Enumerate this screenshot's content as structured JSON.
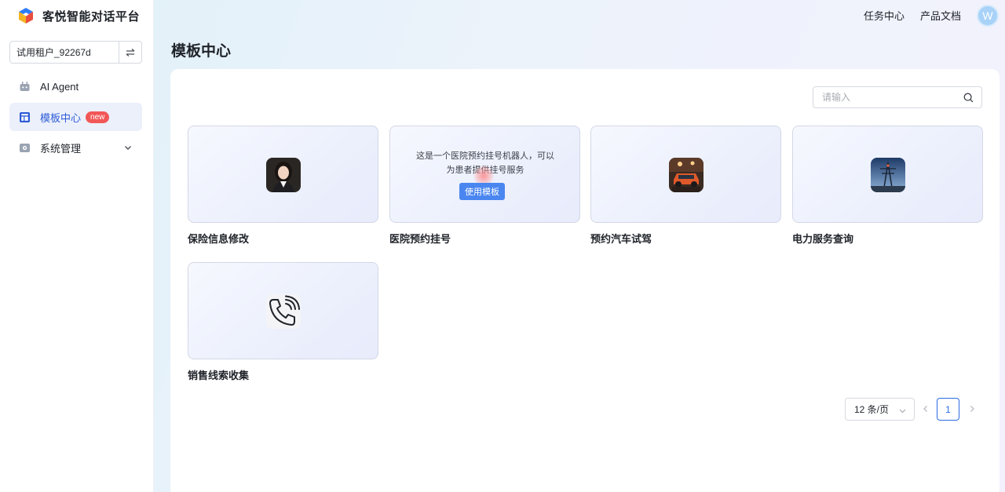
{
  "app": {
    "title": "客悦智能对话平台"
  },
  "tenant": {
    "name": "试用租户_92267d",
    "switch_icon": "swap-icon"
  },
  "sidebar": {
    "items": [
      {
        "label": "AI Agent",
        "icon": "robot-icon"
      },
      {
        "label": "模板中心",
        "icon": "template-grid-icon",
        "badge": "new",
        "active": true
      },
      {
        "label": "系统管理",
        "icon": "settings-icon",
        "expandable": true
      }
    ]
  },
  "topbar": {
    "links": [
      "任务中心",
      "产品文档"
    ],
    "avatar_letter": "W"
  },
  "main": {
    "page_title": "模板中心",
    "search": {
      "placeholder": "请输入"
    }
  },
  "templates": [
    {
      "label": "保险信息修改",
      "thumb": "female-agent-avatar"
    },
    {
      "label": "医院预约挂号",
      "description": "这是一个医院预约挂号机器人，可以为患者提供挂号服务",
      "button": "使用模板",
      "hovered": true
    },
    {
      "label": "预约汽车试驾",
      "thumb": "orange-car-photo"
    },
    {
      "label": "电力服务查询",
      "thumb": "power-tower-photo"
    },
    {
      "label": "销售线索收集",
      "thumb": "phone-call-icon"
    }
  ],
  "pagination": {
    "page_size": "12 条/页",
    "current_page": "1"
  },
  "colors": {
    "accent": "#2d6be4",
    "badge": "#f25757",
    "button": "#4a86f0"
  }
}
